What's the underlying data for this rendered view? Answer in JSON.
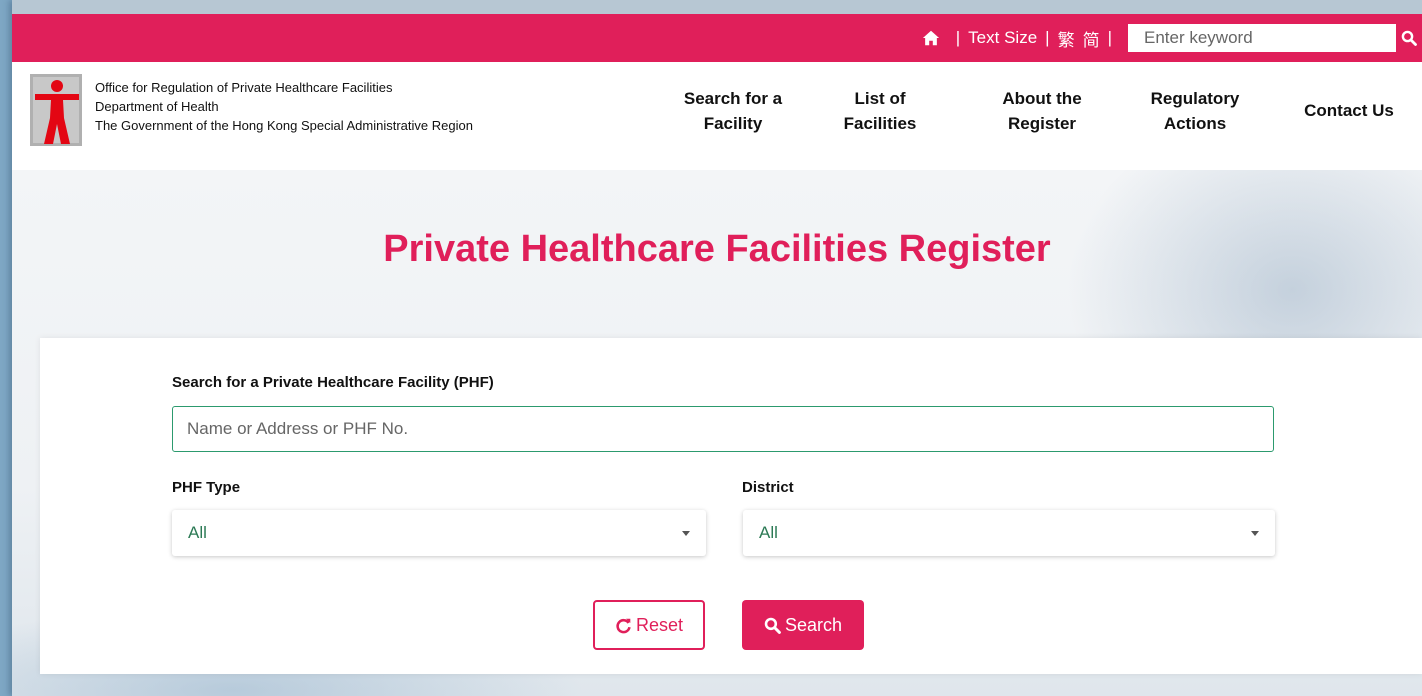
{
  "topbar": {
    "text_size": "Text Size",
    "lang_traditional": "繁",
    "lang_simplified": "简",
    "keyword_placeholder": "Enter keyword"
  },
  "header": {
    "org_line1": "Office for Regulation of Private Healthcare Facilities",
    "org_line2": "Department of Health",
    "org_line3": "The Government of the Hong Kong Special Administrative Region",
    "nav": [
      {
        "line1": "Search for a",
        "line2": "Facility"
      },
      {
        "line1": "List of",
        "line2": "Facilities"
      },
      {
        "line1": "About the",
        "line2": "Register"
      },
      {
        "line1": "Regulatory",
        "line2": "Actions"
      },
      {
        "line1": "Contact Us",
        "line2": ""
      }
    ]
  },
  "page_title": "Private Healthcare Facilities Register",
  "form": {
    "search_label": "Search for a Private Healthcare Facility (PHF)",
    "search_placeholder": "Name or Address or PHF No.",
    "phf_type_label": "PHF Type",
    "phf_type_value": "All",
    "district_label": "District",
    "district_value": "All",
    "reset_label": "Reset",
    "search_label_btn": "Search"
  },
  "colors": {
    "brand": "#e01f5a",
    "input_border": "#2c9a6e",
    "select_text": "#2c7a55"
  }
}
